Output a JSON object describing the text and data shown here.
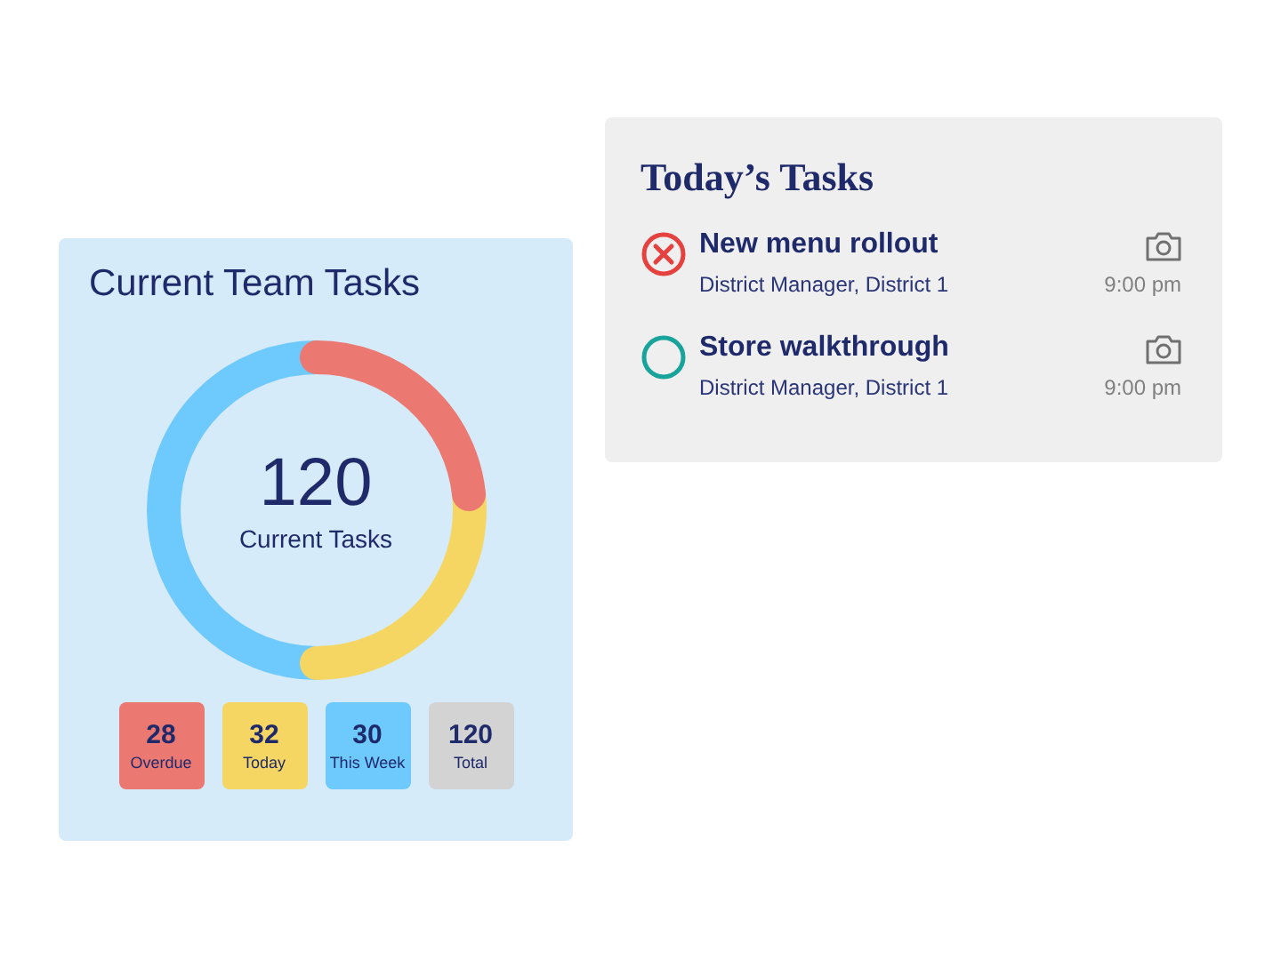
{
  "team_card": {
    "title": "Current Team Tasks",
    "center_value": "120",
    "center_label": "Current Tasks",
    "stats": [
      {
        "value": "28",
        "label": "Overdue",
        "color": "#ec7872"
      },
      {
        "value": "32",
        "label": "Today",
        "color": "#f6d662"
      },
      {
        "value": "30",
        "label": "This Week",
        "color": "#6ec9fd"
      },
      {
        "value": "120",
        "label": "Total",
        "color": "#d3d3d3"
      }
    ]
  },
  "todays_tasks": {
    "title": "Today’s Tasks",
    "tasks": [
      {
        "kind": "overdue",
        "name": "New menu rollout",
        "assignee": "District Manager, District 1",
        "time": "9:00 pm"
      },
      {
        "kind": "open",
        "name": "Store walkthrough",
        "assignee": "District Manager, District 1",
        "time": "9:00 pm"
      }
    ]
  }
}
